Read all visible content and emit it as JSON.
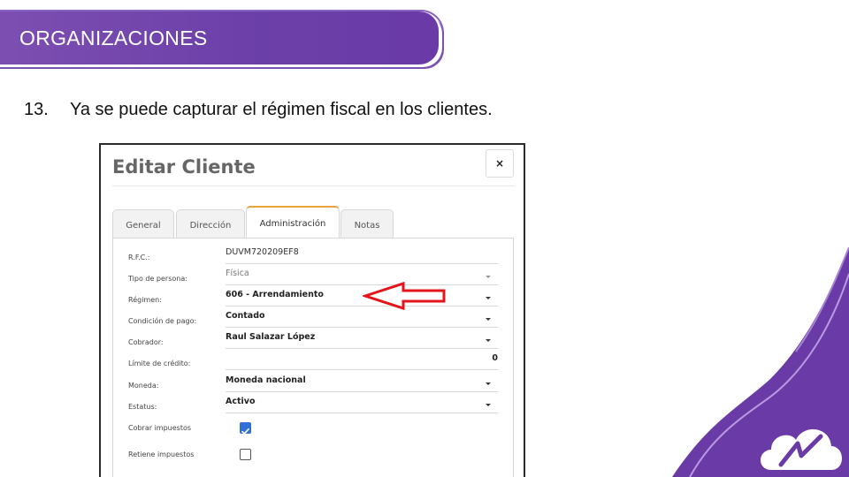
{
  "banner": {
    "title": "ORGANIZACIONES"
  },
  "step": {
    "number": "13.",
    "text": "Ya se puede capturar el régimen fiscal en los clientes."
  },
  "modal": {
    "title": "Editar Cliente",
    "close_label": "×",
    "tabs": [
      {
        "label": "General",
        "active": false
      },
      {
        "label": "Dirección",
        "active": false
      },
      {
        "label": "Administración",
        "active": true
      },
      {
        "label": "Notas",
        "active": false
      }
    ],
    "fields": {
      "rfc": {
        "label": "R.F.C.:",
        "value": "DUVM720209EF8"
      },
      "tipo_persona": {
        "label": "Tipo de persona:",
        "value": "Física"
      },
      "regimen": {
        "label": "Régimen:",
        "value": "606 - Arrendamiento"
      },
      "condicion_pago": {
        "label": "Condición de pago:",
        "value": "Contado"
      },
      "cobrador": {
        "label": "Cobrador:",
        "value": "Raul Salazar López"
      },
      "limite_credito": {
        "label": "Límite de crédito:",
        "value": "0"
      },
      "moneda": {
        "label": "Moneda:",
        "value": "Moneda nacional"
      },
      "estatus": {
        "label": "Estatus:",
        "value": "Activo"
      },
      "cobrar_impuestos": {
        "label": "Cobrar impuestos",
        "checked": true
      },
      "retiene_impuestos": {
        "label": "Retiene impuestos",
        "checked": false
      }
    }
  },
  "colors": {
    "banner_purple": "#6b3fa8",
    "tab_accent": "#e9a23b",
    "arrow_red": "#e3141b",
    "checkbox_blue": "#2f6fd6"
  }
}
